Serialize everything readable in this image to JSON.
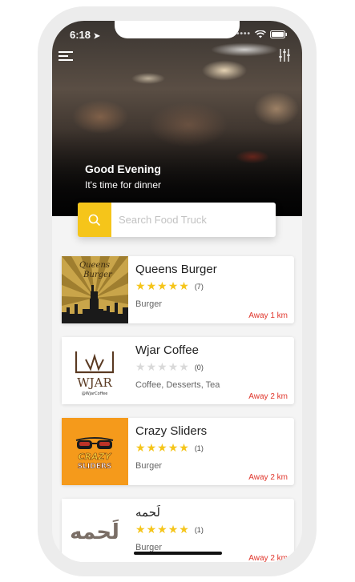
{
  "status": {
    "time": "6:18"
  },
  "hero": {
    "greeting": "Good Evening",
    "subtitle": "It's time for dinner"
  },
  "search": {
    "placeholder": "Search Food Truck"
  },
  "colors": {
    "accent": "#f5c51a",
    "distance": "#e0352b"
  },
  "trucks": [
    {
      "name": "Queens Burger",
      "rating": 5,
      "reviews": "(7)",
      "category": "Burger",
      "distance": "Away 1 km",
      "logo_text": [
        "Queens",
        "Burger"
      ]
    },
    {
      "name": "Wjar Coffee",
      "rating": 0,
      "reviews": "(0)",
      "category": "Coffee, Desserts, Tea",
      "distance": "Away 2 km",
      "logo_text": [
        "WJAR",
        "@WjarCoffee"
      ]
    },
    {
      "name": "Crazy Sliders",
      "rating": 5,
      "reviews": "(1)",
      "category": "Burger",
      "distance": "Away 2 km",
      "logo_text": [
        "CRAZY",
        "SLIDERS"
      ]
    },
    {
      "name": "لَحمه",
      "rating": 5,
      "reviews": "(1)",
      "category": "Burger",
      "distance": "Away 2 km",
      "logo_text": [
        "لَحمه"
      ]
    }
  ]
}
